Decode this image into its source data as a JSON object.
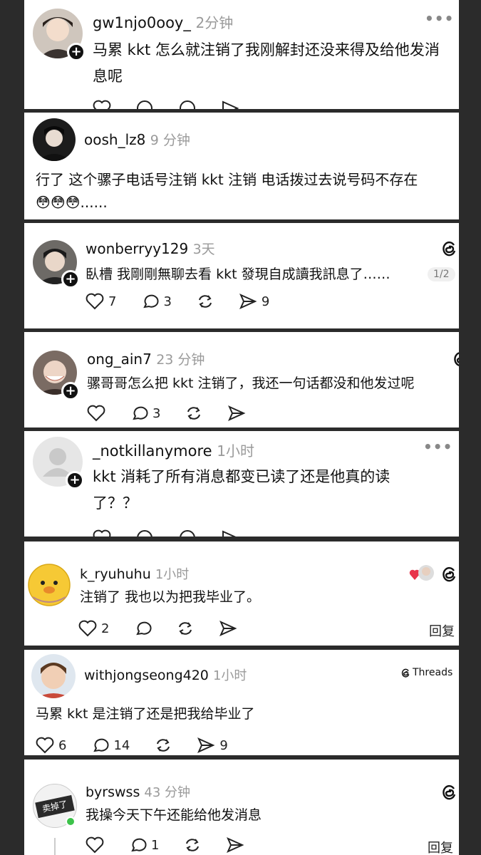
{
  "posts": [
    {
      "user": "gw1njo0ooy_",
      "time": "2分钟",
      "text": "马累 kkt 怎么就注销了我刚解封还没来得及给他发消息呢"
    },
    {
      "user": "oosh_lz8",
      "time": "9 分钟",
      "text": "行了 这个骡子电话号注销 kkt 注销  电话拨过去说号码不存在",
      "emoji": "😳😳😳......"
    },
    {
      "user": "wonberryy129",
      "time": "3天",
      "text": "臥槽 我剛剛無聊去看 kkt 發現自成讀我訊息了……",
      "page": "1/2",
      "likes": "7",
      "comments": "3",
      "shares": "9"
    },
    {
      "user": "ong_ain7",
      "time": "23 分钟",
      "text": "骡哥哥怎么把 kkt 注销了，我还一句话都没和他发过呢",
      "comments": "3"
    },
    {
      "user": "_notkillanymore",
      "time": "1小时",
      "text": "kkt 消耗了所有消息都变已读了还是他真的读了？？"
    },
    {
      "user": "k_ryuhuhu",
      "time": "1小时",
      "text": "注销了 我也以为把我毕业了。",
      "likes": "2",
      "reply": "回复"
    },
    {
      "user": "withjongseong420",
      "time": "1小时",
      "text": "马累 kkt 是注销了还是把我给毕业了",
      "likes": "6",
      "comments": "14",
      "shares": "9",
      "brand": "Threads"
    },
    {
      "user": "byrswss",
      "time": "43 分钟",
      "text": "我操今天下午还能给他发消息",
      "comments": "1",
      "reply": "回复",
      "avatar_text": "卖掉了"
    }
  ],
  "icons": {
    "more": "more-horizontal-icon",
    "like": "heart-icon",
    "comment": "comment-icon",
    "repost": "repost-icon",
    "share": "share-icon",
    "threads": "threads-logo-icon"
  }
}
